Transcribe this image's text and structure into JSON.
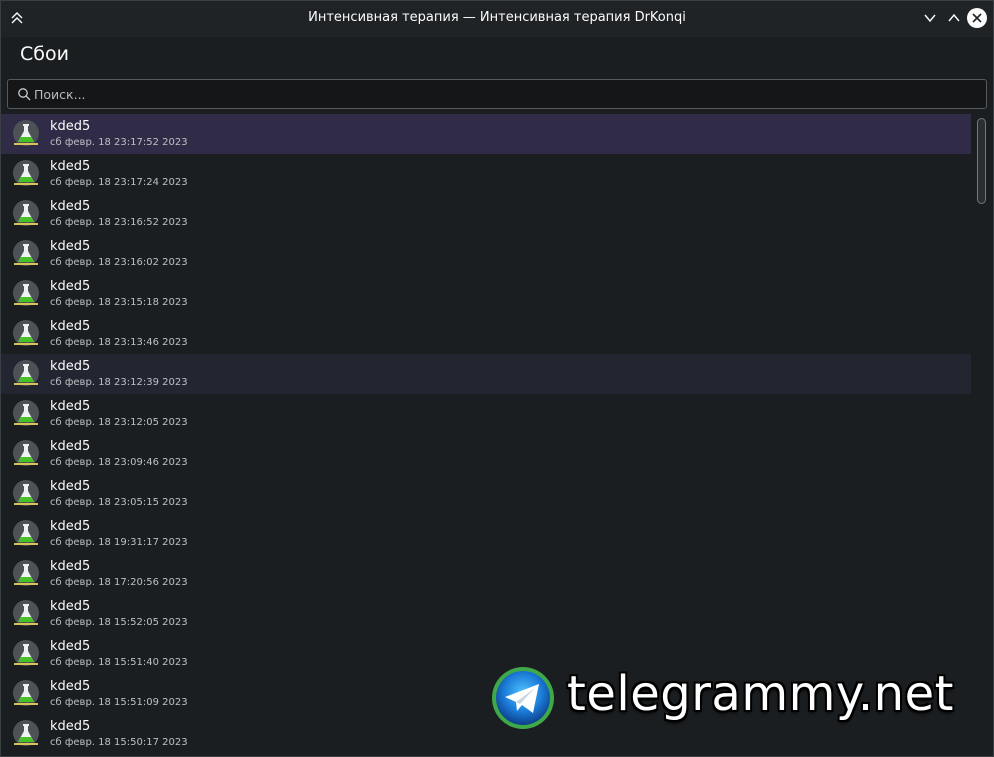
{
  "window": {
    "title": "Интенсивная терапия — Интенсивная терапия DrKonqi"
  },
  "heading": "Сбои",
  "search": {
    "placeholder": "Поиск...",
    "value": ""
  },
  "crashes": [
    {
      "name": "kded5",
      "date": "сб февр. 18 23:17:52 2023",
      "state": "selected"
    },
    {
      "name": "kded5",
      "date": "сб февр. 18 23:17:24 2023",
      "state": ""
    },
    {
      "name": "kded5",
      "date": "сб февр. 18 23:16:52 2023",
      "state": ""
    },
    {
      "name": "kded5",
      "date": "сб февр. 18 23:16:02 2023",
      "state": ""
    },
    {
      "name": "kded5",
      "date": "сб февр. 18 23:15:18 2023",
      "state": ""
    },
    {
      "name": "kded5",
      "date": "сб февр. 18 23:13:46 2023",
      "state": ""
    },
    {
      "name": "kded5",
      "date": "сб февр. 18 23:12:39 2023",
      "state": "hover"
    },
    {
      "name": "kded5",
      "date": "сб февр. 18 23:12:05 2023",
      "state": ""
    },
    {
      "name": "kded5",
      "date": "сб февр. 18 23:09:46 2023",
      "state": ""
    },
    {
      "name": "kded5",
      "date": "сб февр. 18 23:05:15 2023",
      "state": ""
    },
    {
      "name": "kded5",
      "date": "сб февр. 18 19:31:17 2023",
      "state": ""
    },
    {
      "name": "kded5",
      "date": "сб февр. 18 17:20:56 2023",
      "state": ""
    },
    {
      "name": "kded5",
      "date": "сб февр. 18 15:52:05 2023",
      "state": ""
    },
    {
      "name": "kded5",
      "date": "сб февр. 18 15:51:40 2023",
      "state": ""
    },
    {
      "name": "kded5",
      "date": "сб февр. 18 15:51:09 2023",
      "state": ""
    },
    {
      "name": "kded5",
      "date": "сб февр. 18 15:50:17 2023",
      "state": ""
    }
  ],
  "icons": {
    "window_menu": "chevrons-up-icon",
    "minimize": "chevron-down-icon",
    "maximize": "chevron-up-icon",
    "close": "close-icon",
    "search": "search-icon",
    "crash_item": "flask-icon"
  },
  "watermark": {
    "text": "telegrammy.net"
  },
  "colors": {
    "selected_row": "#302b47",
    "hover_row": "#232630",
    "background": "#1b1e20"
  }
}
